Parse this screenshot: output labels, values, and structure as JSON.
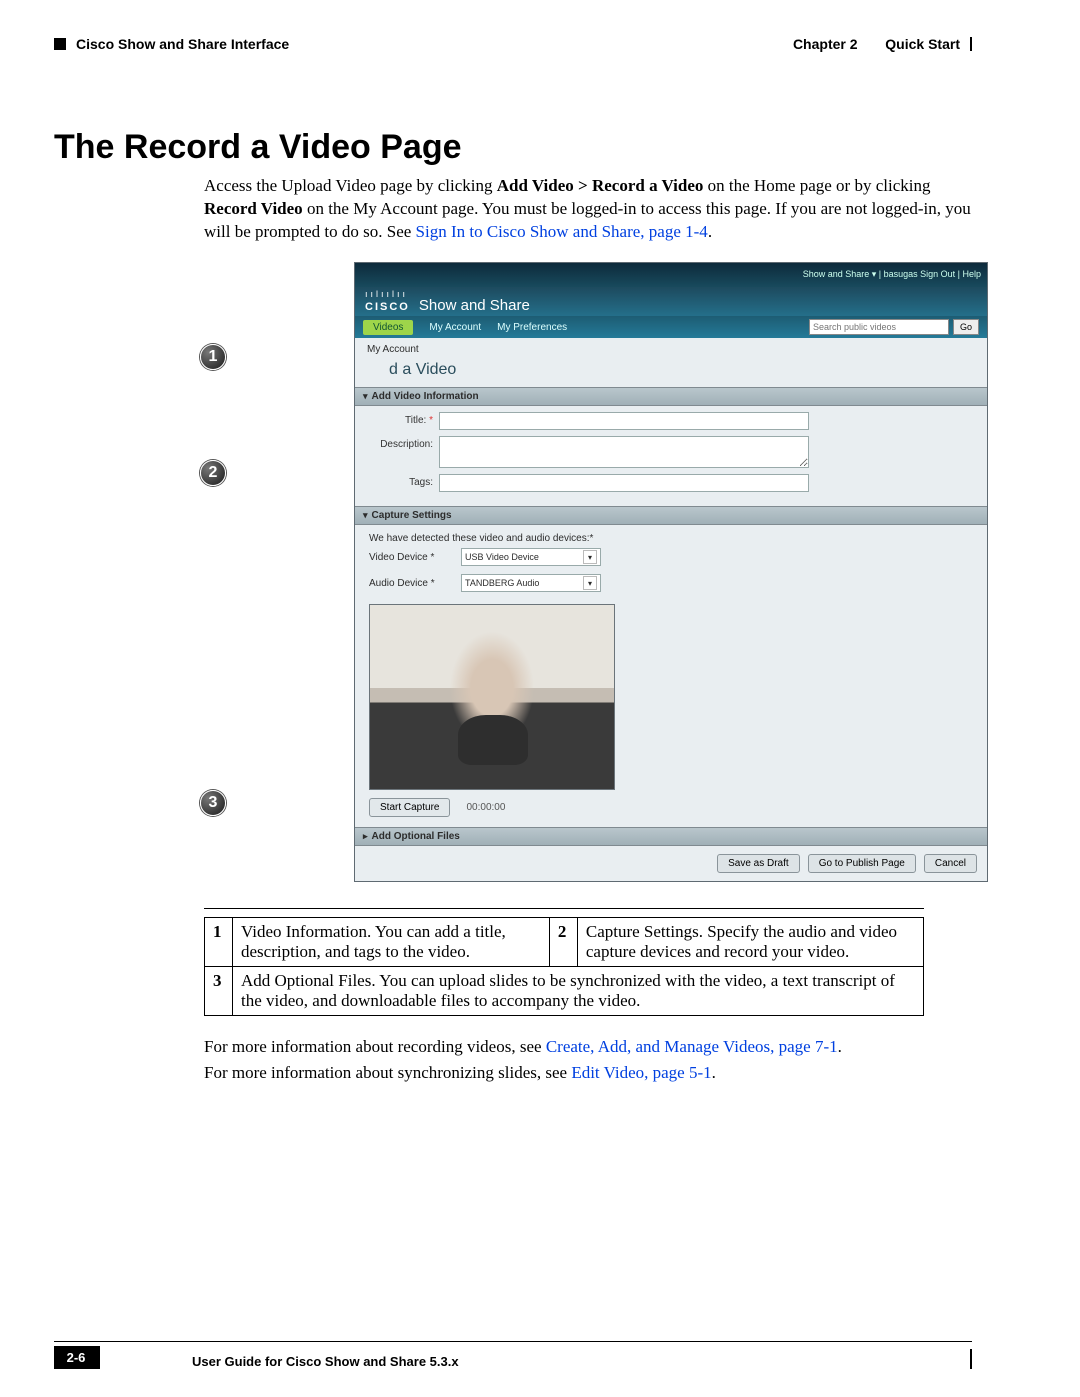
{
  "header": {
    "left_square": "■",
    "section": "Cisco Show and Share Interface",
    "chapter": "Chapter 2",
    "chapter_title": "Quick Start"
  },
  "title": "The Record a Video Page",
  "intro": {
    "pre1": "Access the Upload Video page by clicking ",
    "b1": "Add Video > Record a Video",
    "mid1": " on the Home page or by clicking ",
    "b2": "Record Video",
    "mid2": " on the My Account page. You must be logged-in to access this page. If you are not logged-in, you will be prompted to do so. See ",
    "link1": "Sign In to Cisco Show and Share, page 1-4",
    "end1": "."
  },
  "app": {
    "top_links": "Show and Share  ▾  | basugas Sign Out | Help",
    "logo_bars": "ıılıılıı",
    "logo_word": "CISCO",
    "product": "Show and Share",
    "tab_videos": "Videos",
    "tab_account": "My Account",
    "tab_prefs": "My Preferences",
    "search_placeholder": "Search public videos",
    "go": "Go",
    "crumb": "My Account",
    "page_title": "d a Video",
    "acc1": "Add Video Information",
    "title_lbl": "Title:",
    "desc_lbl": "Description:",
    "tags_lbl": "Tags:",
    "acc2": "Capture Settings",
    "detect_msg": "We have detected these video and audio devices:*",
    "video_dev_lbl": "Video Device *",
    "video_dev_val": "USB Video Device",
    "audio_dev_lbl": "Audio Device *",
    "audio_dev_val": "TANDBERG Audio",
    "start_capture": "Start Capture",
    "timer": "00:00:00",
    "acc3": "Add Optional Files",
    "save_draft": "Save as Draft",
    "publish": "Go to Publish Page",
    "cancel": "Cancel"
  },
  "callouts": {
    "c1": "1",
    "c2": "2",
    "c3": "3"
  },
  "legend": {
    "n1": "1",
    "t1": "Video Information. You can add a title, description, and tags to the video.",
    "n2": "2",
    "t2": "Capture Settings. Specify the audio and video capture devices and record your video.",
    "n3": "3",
    "t3": "Add Optional Files. You can upload slides to be synchronized with the video, a text transcript of the video, and downloadable files to accompany the video."
  },
  "after": {
    "p1a": "For more information about recording videos, see ",
    "p1link": "Create, Add, and Manage Videos, page 7-1",
    "p1b": ".",
    "p2a": "For more information about synchronizing slides, see ",
    "p2link": "Edit Video, page 5-1",
    "p2b": "."
  },
  "footer": {
    "title": "User Guide for Cisco Show and Share 5.3.x",
    "page": "2-6"
  }
}
